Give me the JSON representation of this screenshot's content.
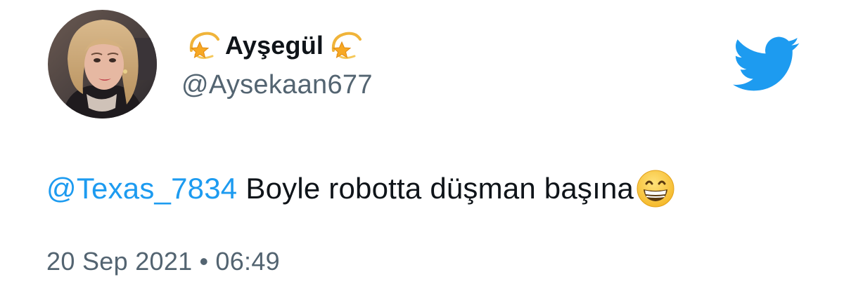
{
  "tweet": {
    "author": {
      "display_name": "Ayşegül",
      "handle": "@Aysekaan677",
      "name_prefix_icon": "dizzy-star-icon",
      "name_suffix_icon": "dizzy-star-icon"
    },
    "platform_icon": "twitter-bird-icon",
    "body": {
      "mention": "@Texas_7834",
      "text": "Boyle robotta düşman başına",
      "trailing_emoji": "grinning-face-emoji-icon"
    },
    "date": "20 Sep 2021",
    "separator": "•",
    "time": "06:49"
  },
  "colors": {
    "accent": "#1d9bf0",
    "text": "#0f1419",
    "secondary_text": "#536471",
    "background": "#ffffff"
  }
}
